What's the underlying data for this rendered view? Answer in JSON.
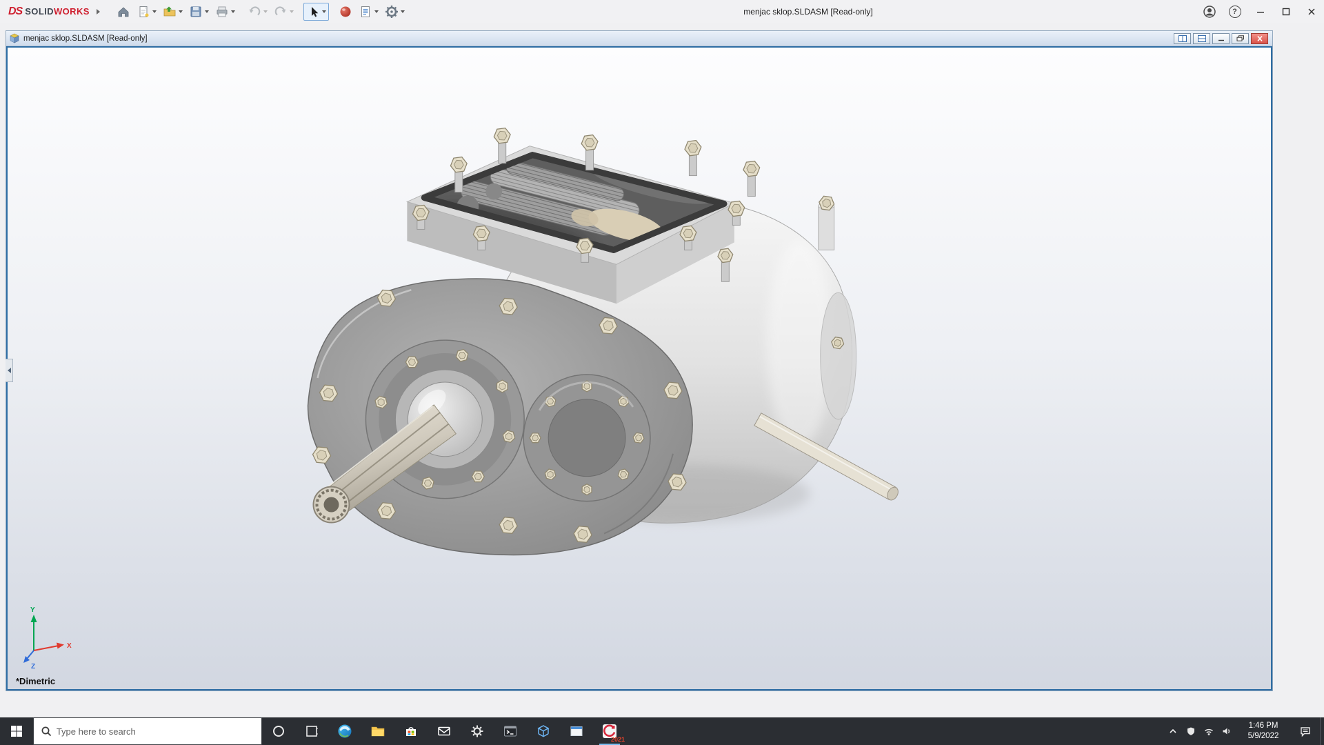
{
  "app": {
    "brand_ds": "DS",
    "brand_solid": "SOLID",
    "brand_works": "WORKS",
    "title": "menjac sklop.SLDASM [Read-only]",
    "help_glyph": "?"
  },
  "doc": {
    "title": "menjac sklop.SLDASM [Read-only]"
  },
  "viewport": {
    "view_label": "*Dimetric",
    "triad": {
      "x": "X",
      "y": "Y",
      "z": "Z"
    }
  },
  "taskbar": {
    "search_placeholder": "Type here to search",
    "sw_year": "2021",
    "clock": {
      "time": "1:46 PM",
      "date": "5/9/2022"
    }
  }
}
